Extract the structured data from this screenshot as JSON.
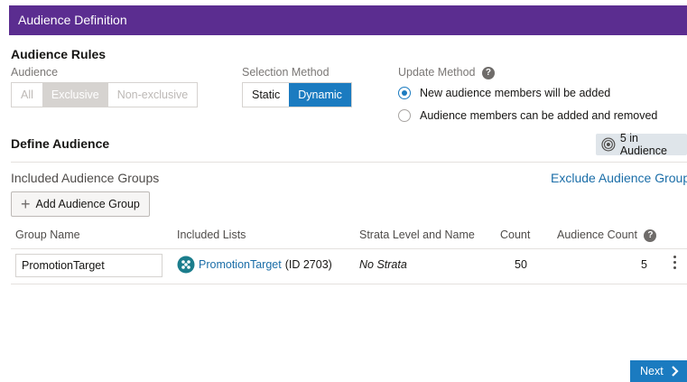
{
  "header": {
    "title": "Audience Definition"
  },
  "audience_rules": {
    "title": "Audience Rules",
    "audience_label": "Audience",
    "audience_options": [
      "All",
      "Exclusive",
      "Non-exclusive"
    ],
    "audience_selected": "Exclusive",
    "selection_method_label": "Selection Method",
    "selection_options": [
      "Static",
      "Dynamic"
    ],
    "selection_selected": "Dynamic",
    "update_method_label": "Update Method",
    "update_options": [
      {
        "label": "New audience members will be added",
        "checked": true
      },
      {
        "label": "Audience members can be added and removed",
        "checked": false
      }
    ]
  },
  "define_audience": {
    "title": "Define Audience",
    "badge": "5 in Audience",
    "included_groups_label": "Included Audience Groups",
    "exclude_link": "Exclude Audience Groups",
    "add_group_button": "Add Audience Group"
  },
  "table": {
    "headers": [
      "Group Name",
      "Included Lists",
      "Strata Level and Name",
      "Count",
      "Audience Count"
    ],
    "rows": [
      {
        "group_name": "PromotionTarget",
        "list_name": "PromotionTarget",
        "list_id": "(ID 2703)",
        "strata": "No Strata",
        "count": "50",
        "audience_count": "5"
      }
    ]
  },
  "footer": {
    "next_button": "Next"
  },
  "colors": {
    "header_bg": "#5b2d90",
    "accent": "#1b7bc0",
    "link": "#1b6ea8"
  }
}
